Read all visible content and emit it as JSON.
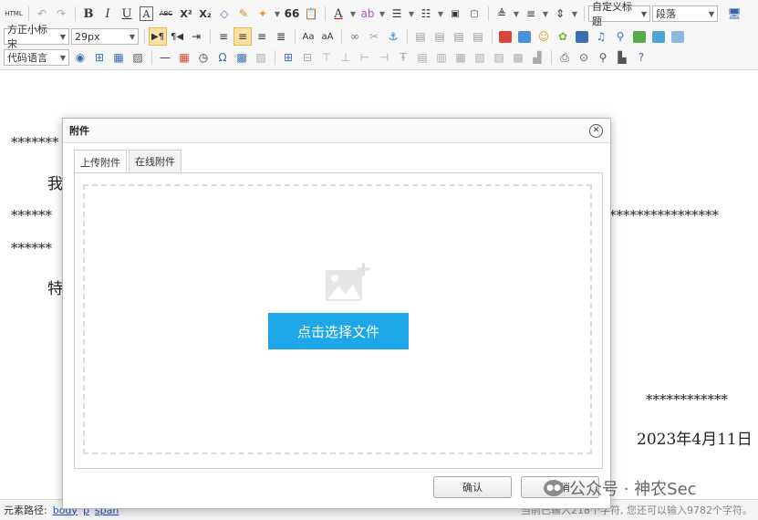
{
  "toolbar": {
    "row1": {
      "html_label": "HTML",
      "bold": "B",
      "italic": "I",
      "underline": "U",
      "fontborder": "A",
      "strikethrough": "ABC",
      "superscript": "X²",
      "subscript": "X₂",
      "blockquote": "66",
      "custom_heading": "自定义标题",
      "paragraph": "段落"
    },
    "row2": {
      "font_family": "方正小标宋",
      "font_size": "29px"
    },
    "row3": {
      "code_language": "代码语言"
    }
  },
  "editor": {
    "lines": [
      {
        "text": "*******"
      },
      {
        "text": "我"
      },
      {
        "text": "******"
      },
      {
        "text": "****************"
      },
      {
        "text": "******"
      },
      {
        "text": "特"
      },
      {
        "text": "************"
      },
      {
        "text": "2023年4月11日"
      }
    ]
  },
  "status": {
    "path_label": "元素路径:",
    "path_items": [
      "body",
      "p",
      "span"
    ],
    "count_text": "当前已输入218个字符, 您还可以输入9782个字符。"
  },
  "dialog": {
    "title": "附件",
    "tabs": [
      {
        "label": "上传附件",
        "active": true
      },
      {
        "label": "在线附件",
        "active": false
      }
    ],
    "pick_button": "点击选择文件",
    "ok_button": "确认",
    "cancel_button": "取消"
  },
  "watermark": {
    "text": "公众号 · 神农Sec"
  },
  "colors": {
    "accent": "#1ea7e8",
    "toolbar_bg": "#f6f6f6",
    "active_btn": "#f9e1a6"
  }
}
